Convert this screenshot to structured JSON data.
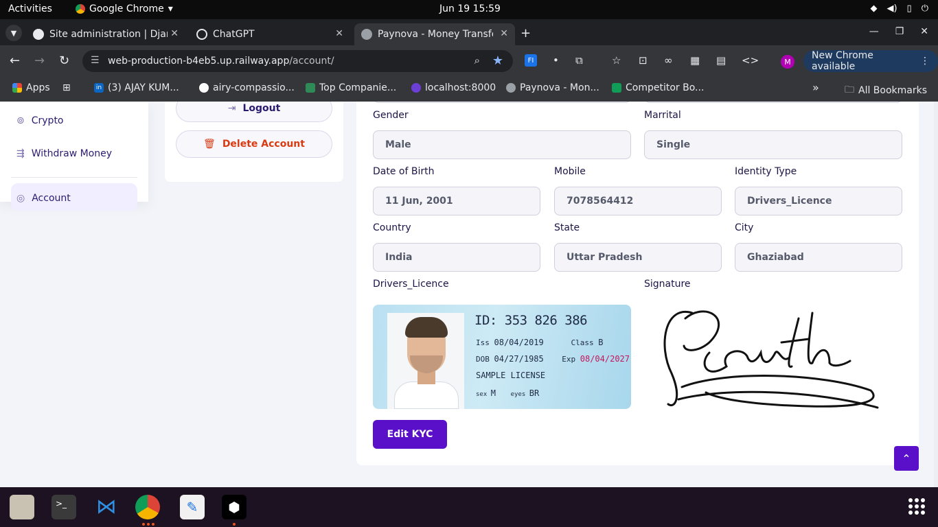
{
  "topbar": {
    "activities": "Activities",
    "app_name": "Google Chrome",
    "clock": "Jun 19  15:59"
  },
  "tabs": [
    {
      "title": "Site administration | Djan",
      "active": false
    },
    {
      "title": "ChatGPT",
      "active": false
    },
    {
      "title": "Paynova - Money Transfe",
      "active": true
    }
  ],
  "omnibox": {
    "host": "web-production-b4eb5.up.railway.app",
    "path": "/account/"
  },
  "toolbar": {
    "avatar_initial": "M",
    "update_label": "New Chrome available"
  },
  "bookmarks": {
    "items": [
      {
        "label": "Apps"
      },
      {
        "label": "(3) AJAY KUM..."
      },
      {
        "label": "airy-compassio..."
      },
      {
        "label": "Top Companie..."
      },
      {
        "label": "localhost:8000"
      },
      {
        "label": "Paynova - Mon..."
      },
      {
        "label": "Competitor Bo..."
      }
    ],
    "overflow": "»",
    "all_bookmarks": "All Bookmarks"
  },
  "sidebar": {
    "items": [
      {
        "label": "Crypto"
      },
      {
        "label": "Withdraw Money"
      },
      {
        "label": "Account"
      }
    ]
  },
  "actions": {
    "logout": "Logout",
    "delete": "Delete Account"
  },
  "kyc": {
    "gender": {
      "label": "Gender",
      "value": "Male"
    },
    "marital": {
      "label": "Marrital",
      "value": "Single"
    },
    "dob": {
      "label": "Date of Birth",
      "value": "11 Jun, 2001"
    },
    "mobile": {
      "label": "Mobile",
      "value": "7078564412"
    },
    "identity_type": {
      "label": "Identity Type",
      "value": "Drivers_Licence"
    },
    "country": {
      "label": "Country",
      "value": "India"
    },
    "state": {
      "label": "State",
      "value": "Uttar Pradesh"
    },
    "city": {
      "label": "City",
      "value": "Ghaziabad"
    },
    "licence_label": "Drivers_Licence",
    "signature_label": "Signature",
    "edit_button": "Edit KYC"
  },
  "licence_card": {
    "id_line": "ID: 353 826 386",
    "iss_label": "Iss",
    "iss_value": "08/04/2019",
    "class_label": "Class",
    "class_value": "B",
    "dob_label": "DOB",
    "dob_value": "04/27/1985",
    "exp_label": "Exp",
    "exp_value": "08/04/2027",
    "sample": "SAMPLE LICENSE",
    "sex_label": "sex",
    "sex_value": "M",
    "eyes_label": "eyes",
    "eyes_value": "BR"
  },
  "colors": {
    "brand_purple": "#5a0fc8",
    "delete_red": "#d93a12",
    "nav_text": "#2b1a70"
  }
}
